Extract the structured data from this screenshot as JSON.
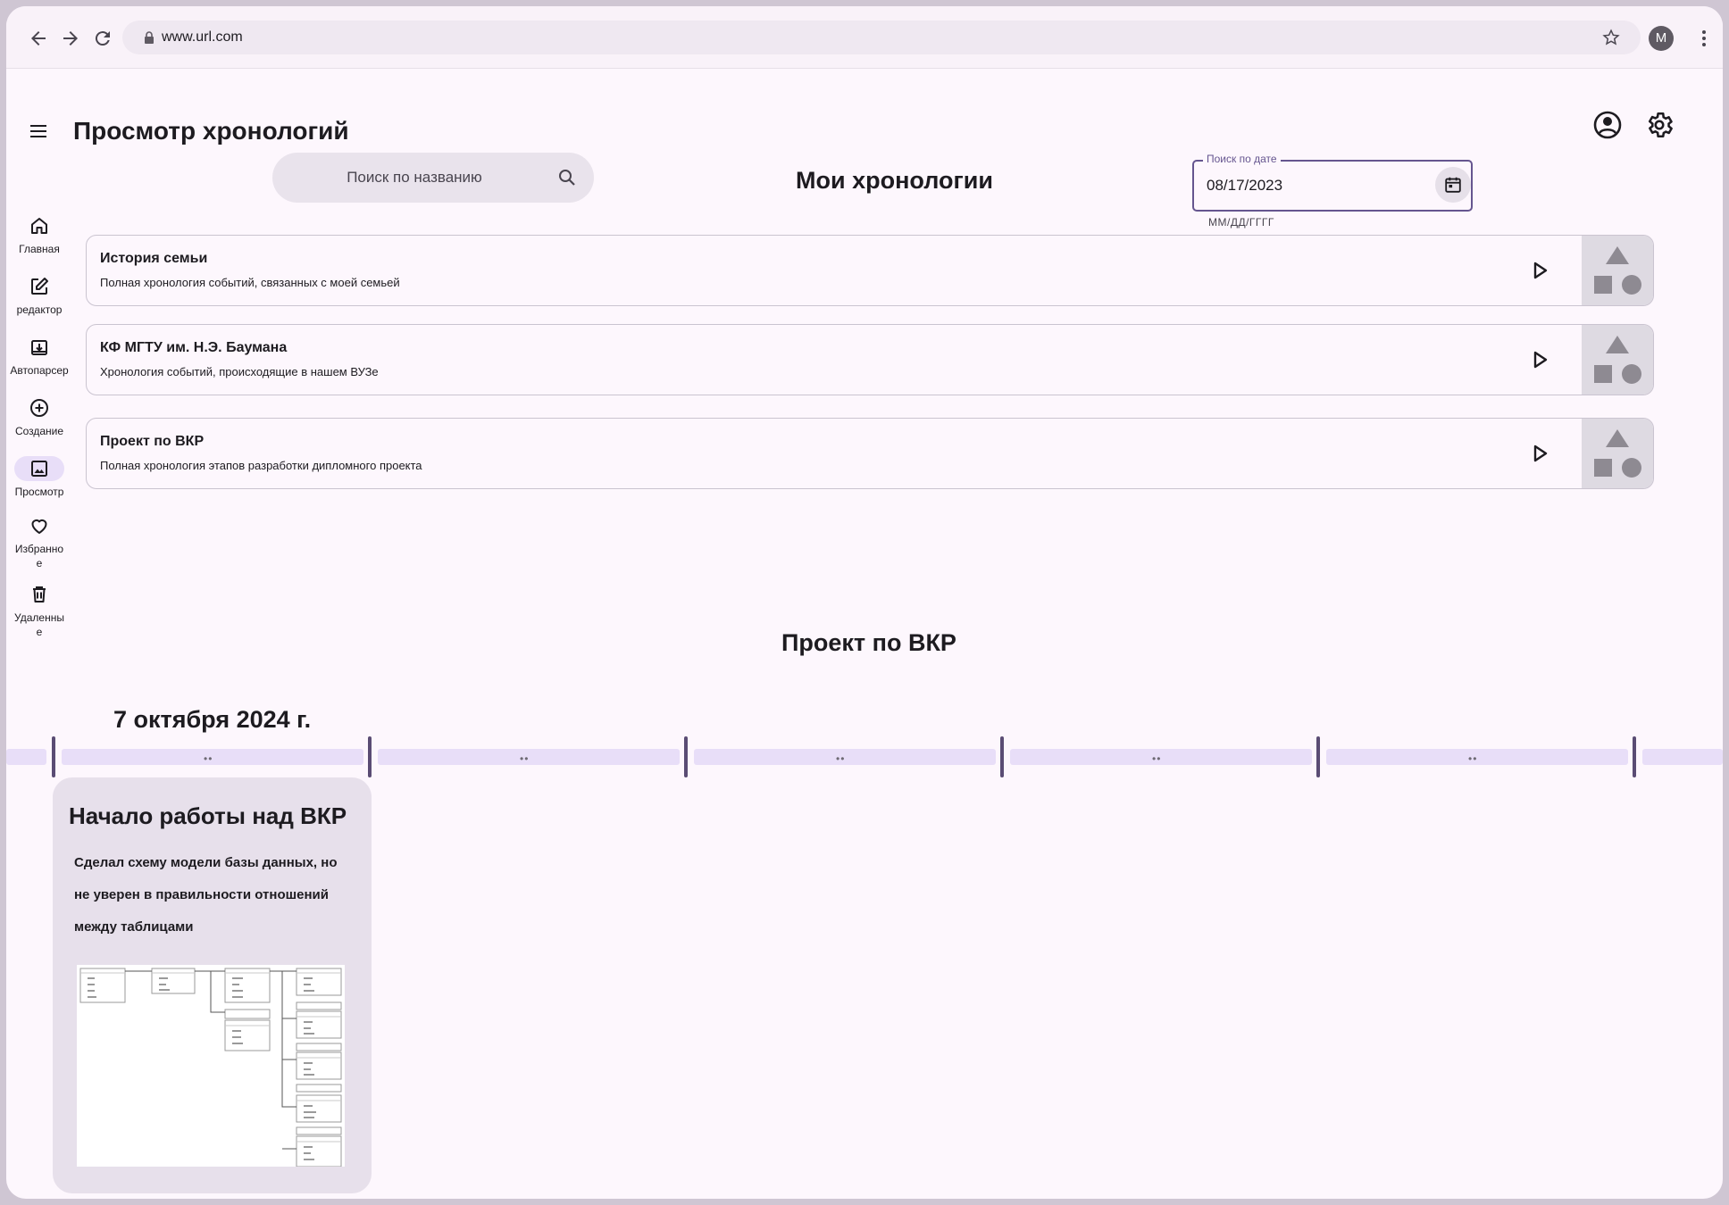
{
  "browser": {
    "url": "www.url.com",
    "profile_initial": "M"
  },
  "app": {
    "page_title": "Просмотр хронологий",
    "section_title": "Мои хронологии"
  },
  "search": {
    "placeholder": "Поиск по названию"
  },
  "date_search": {
    "label": "Поиск по дате",
    "value": "08/17/2023",
    "helper": "ММ/ДД/ГГГГ"
  },
  "rail": {
    "items": [
      {
        "label": "Главная",
        "icon": "home-icon"
      },
      {
        "label": "редактор",
        "icon": "edit-icon"
      },
      {
        "label": "Автопарсер",
        "icon": "download-box-icon"
      },
      {
        "label": "Создание",
        "icon": "add-circle-icon"
      },
      {
        "label": "Просмотр",
        "icon": "image-icon",
        "active": true
      },
      {
        "label": "Избранное",
        "icon": "heart-icon"
      },
      {
        "label": "Удаленные",
        "icon": "trash-icon"
      }
    ]
  },
  "timelines": [
    {
      "title": "История семьи",
      "subtitle": "Полная хронология событий, связанных с моей семьей"
    },
    {
      "title": "КФ МГТУ им. Н.Э. Баумана",
      "subtitle": "Хронология событий, происходящие в нашем ВУЗе"
    },
    {
      "title": "Проект по ВКР",
      "subtitle": "Полная хронология этапов разработки дипломного проекта"
    }
  ],
  "selected_timeline": {
    "title": "Проект по ВКР",
    "date": "7 октября 2024 г.",
    "track_markers": [
      "••",
      "••",
      "••",
      "••",
      "••"
    ],
    "event": {
      "title": "Начало работы над ВКР",
      "text": "Сделал схему модели базы данных, но не уверен в правильности отношений между таблицами",
      "image": "database-schema-diagram"
    }
  },
  "colors": {
    "accent": "#65558f",
    "track": "#e8def8",
    "tick": "#5a4c74",
    "card_bg": "#e7e0eb",
    "page_bg": "#fdf7fd"
  }
}
